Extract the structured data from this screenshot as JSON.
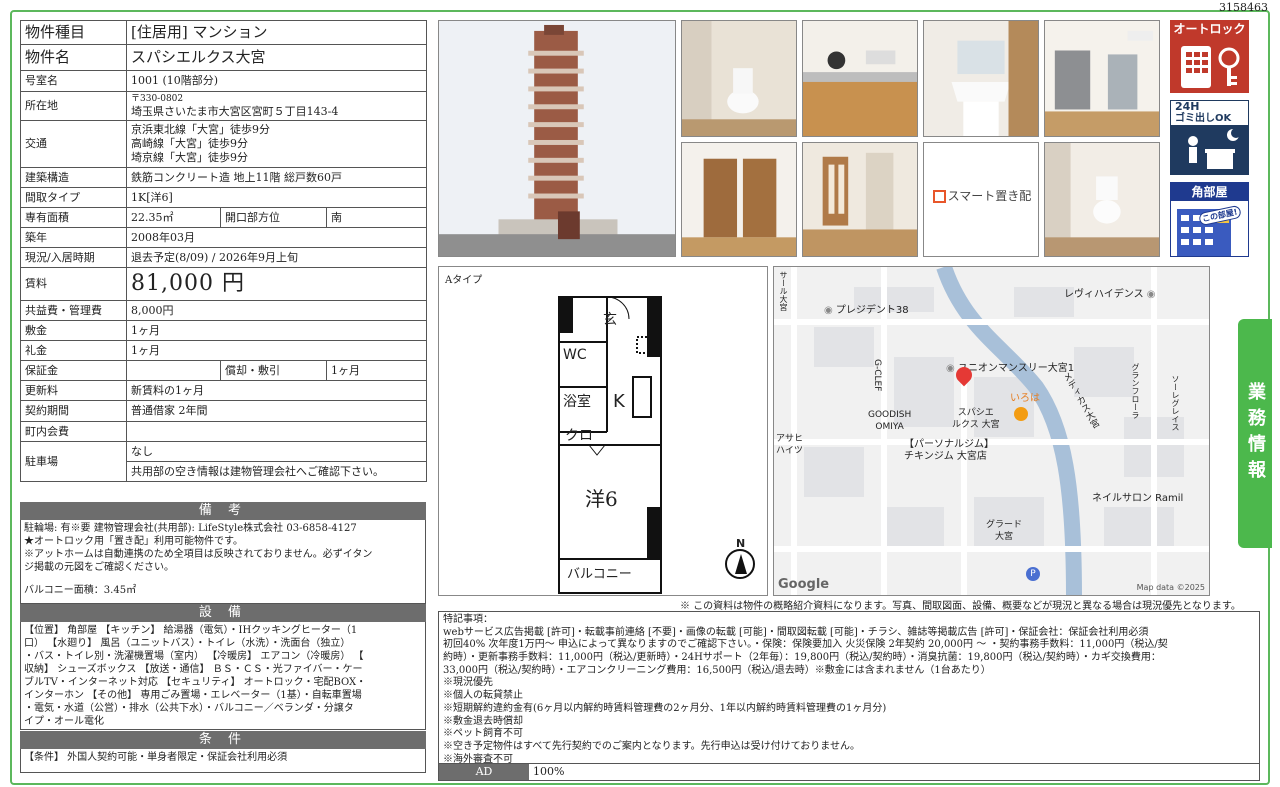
{
  "doc_id": "3158463",
  "property": {
    "rows": {
      "type_label": "物件種目",
      "type_value": "[住居用] マンション",
      "name_label": "物件名",
      "name_value": "スパシエルクス大宮",
      "room_label": "号室名",
      "room_value": "1001 (10階部分)",
      "addr_label": "所在地",
      "addr_zip": "〒330-0802",
      "addr_value": "埼玉県さいたま市大宮区宮町５丁目143-4",
      "traffic_label": "交通",
      "traffic_1": "京浜東北線「大宮」徒歩9分",
      "traffic_2": "高崎線「大宮」徒歩9分",
      "traffic_3": "埼京線「大宮」徒歩9分",
      "struct_label": "建築構造",
      "struct_value": "鉄筋コンクリート造 地上11階 総戸数60戸",
      "layout_label": "間取タイプ",
      "layout_value": "1K[洋6]",
      "area_label": "専有面積",
      "area_value": "22.35㎡",
      "dir_label": "開口部方位",
      "dir_value": "南",
      "built_label": "築年",
      "built_value": "2008年03月",
      "status_label": "現況/入居時期",
      "status_value": "退去予定(8/09)  /  2026年9月上旬",
      "rent_label": "賃料",
      "rent_value": "81,000 円",
      "fee_label": "共益費・管理費",
      "fee_value": "8,000円",
      "deposit_label": "敷金",
      "deposit_value": "1ヶ月",
      "key_label": "礼金",
      "key_value": "1ヶ月",
      "guarantee_label": "保証金",
      "guarantee_value": "",
      "amort_label": "償却・敷引",
      "amort_value": "1ヶ月",
      "renew_label": "更新料",
      "renew_value": "新賃料の1ヶ月",
      "contract_label": "契約期間",
      "contract_value": "普通借家 2年間",
      "town_label": "町内会費",
      "town_value": "",
      "parking_label": "駐車場",
      "parking_value": "なし",
      "parking_note": "共用部の空き情報は建物管理会社へご確認下さい。"
    },
    "biko": {
      "title": "備 考",
      "lines": [
        "駐輪場: 有※要  建物管理会社(共用部): LifeStyle株式会社   03-6858-4127",
        "★オートロック用「置き配」利用可能物件です。",
        "※アットホームは自動連携のため全項目は反映されておりません。必ずイタン",
        "ジ掲載の元図をご確認ください。",
        "",
        "バルコニー面積：3.45㎡"
      ]
    },
    "setsubi": {
      "title": "設 備",
      "lines": [
        "【位置】 角部屋 【キッチン】 給湯器（電気）・IHクッキングヒーター（1",
        "口） 【水廻り】 風呂（ユニットバス）・トイレ（水洗）・洗面台（独立）",
        "・バス・トイレ別・洗濯機置場（室内） 【冷暖房】 エアコン（冷暖房） 【",
        "収納】 シューズボックス 【放送・通信】 ＢＳ・ＣＳ・光ファイバー・ケー",
        "ブルTV・インターネット対応 【セキュリティ】 オートロック・宅配BOX・",
        "インターホン 【その他】 専用ごみ置場・エレベーター（1基）・自転車置場",
        "・電気・水道（公営）・排水（公共下水）・バルコニー／ベランダ・分譲タ",
        "イプ・オール電化"
      ]
    },
    "joken": {
      "title": "条 件",
      "lines": [
        "【条件】 外国人契約可能・単身者限定・保証会社利用必須"
      ]
    }
  },
  "photos": {
    "smart_label": "スマート置き配"
  },
  "icons": {
    "autolock": "オートロック",
    "gomi_line1": "24H",
    "gomi_line2": "ゴミ出しOK",
    "kado": "角部屋",
    "kado_sub": "この部屋!"
  },
  "plan": {
    "type_label": "Aタイプ",
    "genkan": "玄",
    "wc": "WC",
    "yokushitsu": "浴室",
    "k": "K",
    "kuro": "クロ",
    "yo6": "洋6",
    "balcony": "バルコニー",
    "north": "N"
  },
  "map": {
    "labels": {
      "sarl": "サール大宮",
      "president": "プレジデント38",
      "leveil": "レヴィハイデンス",
      "union": "ユニオンマンスリー大宮1",
      "gclef": "G-CLEF",
      "goodish1": "GOODISH",
      "goodish2": "OMIYA",
      "spacie1": "スパシエ",
      "spacie2": "ルクス 大宮",
      "iroha": "いろは",
      "medical": "メディカス大宮",
      "gran1": "グラン",
      "gran2": "フローラ",
      "aqua1": "ソーレ",
      "aqua2": "グレイス",
      "asahi1": "アサヒ",
      "asahi2": "ハイツ",
      "gym1": "【パーソナルジム】",
      "gym2": "チキンジム 大宮店",
      "nail": "ネイルサロン Ramil",
      "grade1": "グラード",
      "grade2": "大宮",
      "google": "Google",
      "copy": "Map data ©2025",
      "parking": "P"
    }
  },
  "tab": {
    "label": "業務情報"
  },
  "note": "※ この資料は物件の概略紹介資料になります。写真、間取図面、設備、概要などが現況と異なる場合は現況優先となります。",
  "special": {
    "lines": [
      "特記事項：",
      "webサービス広告掲載 [許可]・転載事前連絡 [不要]・画像の転載 [可能]・間取図転載 [可能]・チラシ、雑誌等掲載広告 [許可]・保証会社：保証会社利用必須",
      "初回40%  次年度1万円～ 申込によって異なりますのでご確認下さい。・保険：保険要加入 火災保険 2年契約 20,000円 ～ ・契約事務手数料：11,000円（税込/契",
      "約時）・更新事務手数料：11,000円（税込/更新時）・24Hサポート（2年毎）：19,800円（税込/契約時）・消臭抗菌：19,800円（税込/契約時）・カギ交換費用：",
      "33,000円（税込/契約時）・エアコンクリーニング費用：16,500円（税込/退去時）※敷金には含まれません（1台あたり）",
      "※現況優先",
      "※個人の転貸禁止",
      "※短期解約違約金有(6ヶ月以内解約時賃料管理費の2ヶ月分、1年以内解約時賃料管理費の1ヶ月分)",
      "※敷金退去時償却",
      "※ペット飼育不可",
      "※空き予定物件はすべて先行契約でのご案内となります。先行申込は受け付けておりません。",
      "※海外審査不可"
    ]
  },
  "ad": {
    "label": "AD",
    "value": "100%"
  }
}
